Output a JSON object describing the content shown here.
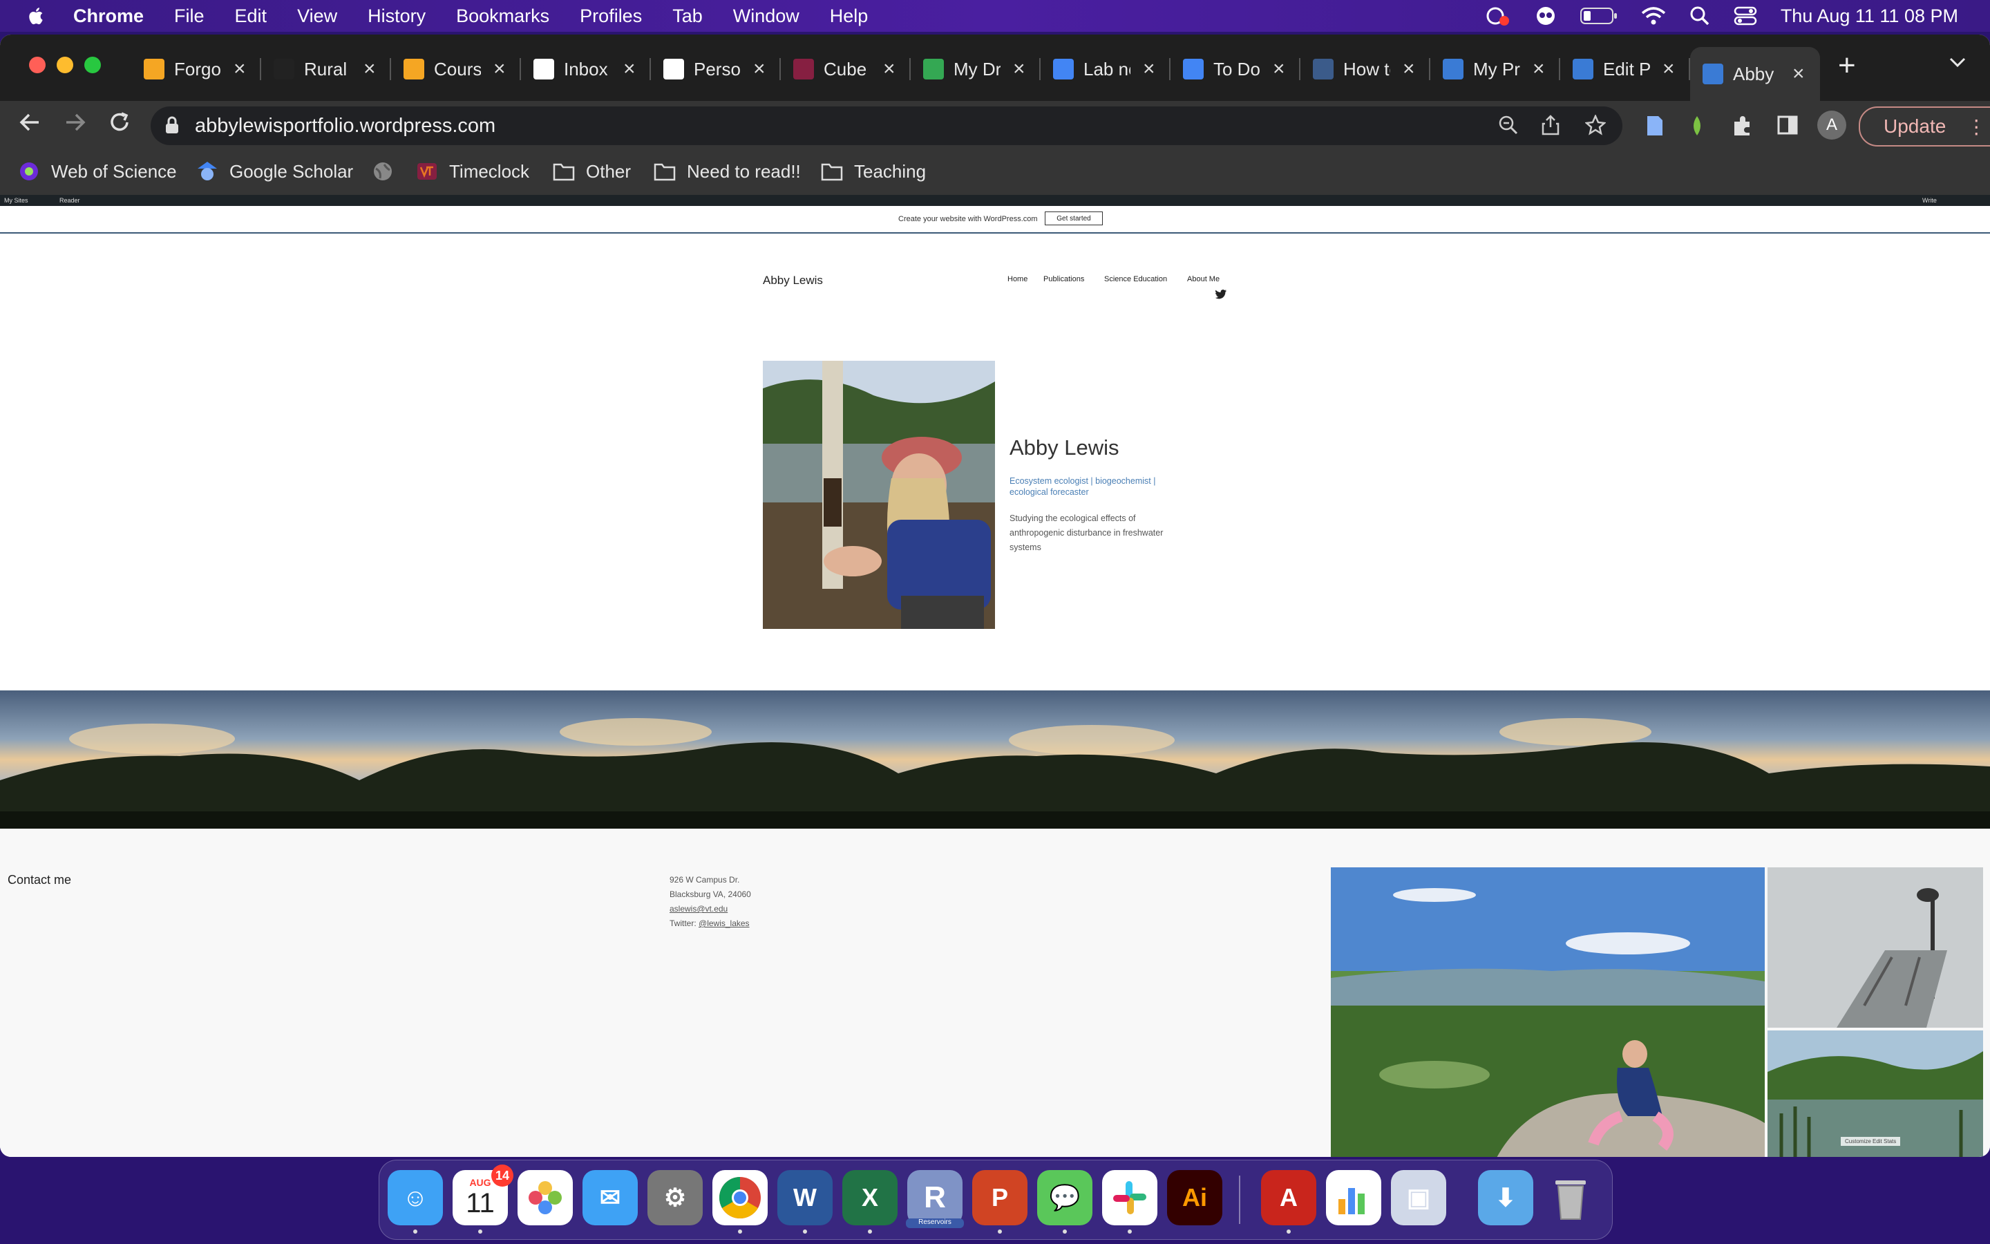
{
  "menubar": {
    "app_name": "Chrome",
    "items": [
      "File",
      "Edit",
      "View",
      "History",
      "Bookmarks",
      "Profiles",
      "Tab",
      "Window",
      "Help"
    ],
    "clock": "Thu Aug 11  11 08 PM"
  },
  "tabs": [
    {
      "label": "Forgot",
      "icon": "overleaf-icon",
      "color": "#f5a623"
    },
    {
      "label": "Rural",
      "icon": "rural-icon",
      "color": "#222222"
    },
    {
      "label": "Course",
      "icon": "overleaf-icon",
      "color": "#f5a623"
    },
    {
      "label": "Inbox",
      "icon": "gmail-icon",
      "color": "#ffffff"
    },
    {
      "label": "Personal",
      "icon": "github-icon",
      "color": "#ffffff"
    },
    {
      "label": "Cube",
      "icon": "vt-icon",
      "color": "#861f41"
    },
    {
      "label": "My Drive",
      "icon": "drive-icon",
      "color": "#34a853"
    },
    {
      "label": "Lab notebook",
      "icon": "docs-icon",
      "color": "#4285f4"
    },
    {
      "label": "To Do",
      "icon": "docs-icon",
      "color": "#4285f4"
    },
    {
      "label": "How to",
      "icon": "tds-icon",
      "color": "#3b5b8a"
    },
    {
      "label": "My Profile",
      "icon": "wordpress-icon",
      "color": "#3a7bd5"
    },
    {
      "label": "Edit Page",
      "icon": "wordpress-icon",
      "color": "#3a7bd5"
    },
    {
      "label": "Abby",
      "icon": "wordpress-icon",
      "color": "#3a7bd5",
      "active": true
    }
  ],
  "omnibox": {
    "url": "abbylewisportfolio.wordpress.com"
  },
  "update_label": "Update",
  "avatar_letter": "A",
  "bookmarks": [
    {
      "label": "Web of Science",
      "icon": "clarivate-icon"
    },
    {
      "label": "Google Scholar",
      "icon": "scholar-icon"
    },
    {
      "label": "",
      "icon": "globe-icon"
    },
    {
      "label": "Timeclock",
      "icon": "vt-icon"
    },
    {
      "label": "Other",
      "icon": "folder-icon"
    },
    {
      "label": "Need to read!!",
      "icon": "folder-icon"
    },
    {
      "label": "Teaching",
      "icon": "folder-icon"
    }
  ],
  "wp": {
    "admin_my_sites": "My Sites",
    "admin_reader": "Reader",
    "admin_write": "Write",
    "banner_text": "Create your website with WordPress.com",
    "banner_button": "Get started"
  },
  "site": {
    "title": "Abby Lewis",
    "nav": [
      "Home",
      "Publications",
      "Science Education",
      "About Me"
    ],
    "hero": {
      "name": "Abby Lewis",
      "tagline": "Ecosystem ecologist | biogeochemist | ecological forecaster",
      "description": "Studying the ecological effects of anthropogenic disturbance in freshwater systems"
    },
    "footer": {
      "contact_heading": "Contact me",
      "address_line1": "926 W Campus Dr.",
      "address_line2": "Blacksburg VA, 24060",
      "email": "aslewis@vt.edu",
      "twitter_prefix": "Twitter: ",
      "twitter_handle": "@lewis_lakes",
      "edit_tools": "Customize  Edit  Stats"
    }
  },
  "dock": {
    "calendar_month": "AUG",
    "calendar_day": "11",
    "calendar_badge": "14",
    "r_label": "Reservoirs"
  }
}
